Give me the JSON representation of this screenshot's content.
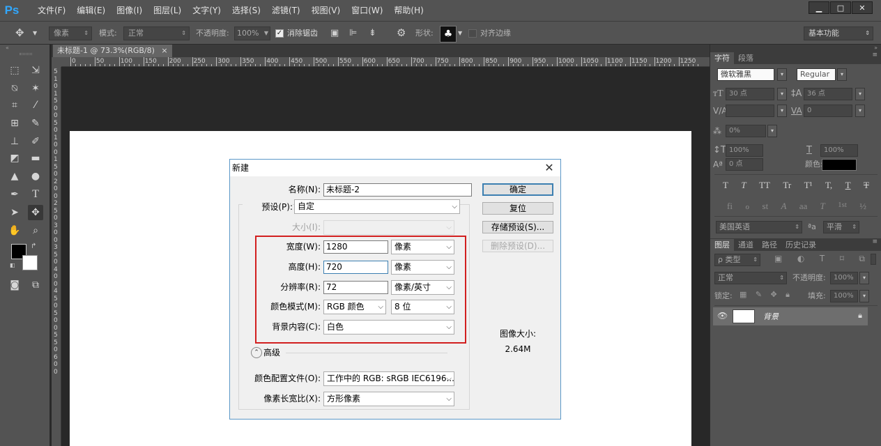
{
  "app": {
    "logo": "Ps"
  },
  "menu": [
    "文件(F)",
    "编辑(E)",
    "图像(I)",
    "图层(L)",
    "文字(Y)",
    "选择(S)",
    "滤镜(T)",
    "视图(V)",
    "窗口(W)",
    "帮助(H)"
  ],
  "window_controls": {
    "minimize": "▁",
    "maximize": "□",
    "close": "✕"
  },
  "options": {
    "tool_value": "像素",
    "mode_label": "模式:",
    "mode_value": "正常",
    "opacity_label": "不透明度:",
    "opacity_value": "100%",
    "antialias_label": "消除锯齿",
    "shape_label": "形状:",
    "align_label": "对齐边缘",
    "workspace": "基本功能"
  },
  "document": {
    "tab_title": "未标题-1 @ 73.3%(RGB/8)",
    "tab_close": "×"
  },
  "ruler": {
    "h_marks": [
      "0",
      "50",
      "100",
      "150",
      "200",
      "250",
      "300",
      "350",
      "400",
      "450",
      "500",
      "550",
      "600",
      "650",
      "700",
      "750",
      "800",
      "850",
      "900",
      "950",
      "1000",
      "1050",
      "1100",
      "1150",
      "1200",
      "1250"
    ],
    "v_marks": [
      "5",
      "1",
      "0",
      "1",
      "5",
      "0",
      "0",
      "5",
      "0",
      "1",
      "0",
      "0",
      "1",
      "5",
      "0",
      "2",
      "0",
      "0",
      "2",
      "5",
      "0",
      "3",
      "0",
      "0",
      "3",
      "5",
      "0",
      "4",
      "0",
      "0",
      "4",
      "5",
      "0",
      "5",
      "0",
      "0",
      "5",
      "5",
      "0",
      "6",
      "0",
      "0"
    ]
  },
  "character_panel": {
    "tabs": [
      "字符",
      "段落"
    ],
    "font_family": "微软雅黑",
    "font_style": "Regular",
    "font_size": "30 点",
    "leading": "36 点",
    "kerning": "",
    "tracking": "0",
    "scale_label": "0%",
    "vscale": "100%",
    "hscale": "100%",
    "baseline": "0 点",
    "color_label": "颜色:",
    "type_buttons": [
      "T",
      "T",
      "TT",
      "Tr",
      "T¹",
      "T,",
      "T",
      "T"
    ],
    "ot_buttons": [
      "fi",
      "ℴ",
      "st",
      "A",
      "aa",
      "T",
      "1st",
      "½"
    ],
    "language": "美国英语",
    "aa_icon": "ªa",
    "aa_mode": "平滑"
  },
  "layers_panel": {
    "tabs": [
      "图层",
      "通道",
      "路径",
      "历史记录"
    ],
    "filter_label": "ρ 类型",
    "blend_mode": "正常",
    "opacity_label": "不透明度:",
    "opacity_value": "100%",
    "lock_label": "锁定:",
    "fill_label": "填充:",
    "fill_value": "100%",
    "layers": [
      {
        "name": "背景",
        "visible": true,
        "locked": true
      }
    ]
  },
  "dialog": {
    "title": "新建",
    "name_label": "名称(N):",
    "name_value": "未标题-2",
    "preset_label": "预设(P):",
    "preset_value": "自定",
    "size_label": "大小(I):",
    "size_value": "",
    "width_label": "宽度(W):",
    "width_value": "1280",
    "width_unit": "像素",
    "height_label": "高度(H):",
    "height_value": "720",
    "height_unit": "像素",
    "resolution_label": "分辨率(R):",
    "resolution_value": "72",
    "resolution_unit": "像素/英寸",
    "colormode_label": "颜色模式(M):",
    "colormode_value": "RGB 颜色",
    "bitdepth_value": "8 位",
    "background_label": "背景内容(C):",
    "background_value": "白色",
    "advanced_label": "高级",
    "profile_label": "颜色配置文件(O):",
    "profile_value": "工作中的 RGB: sRGB IEC6196...",
    "aspect_label": "像素长宽比(X):",
    "aspect_value": "方形像素",
    "ok_button": "确定",
    "reset_button": "复位",
    "save_preset_button": "存储预设(S)...",
    "delete_preset_button": "删除预设(D)...",
    "image_size_label": "图像大小:",
    "image_size_value": "2.64M"
  },
  "colors": {
    "accent": "#3c7fb1",
    "highlight_box": "#d21f1f",
    "canvas": "#ffffff"
  }
}
